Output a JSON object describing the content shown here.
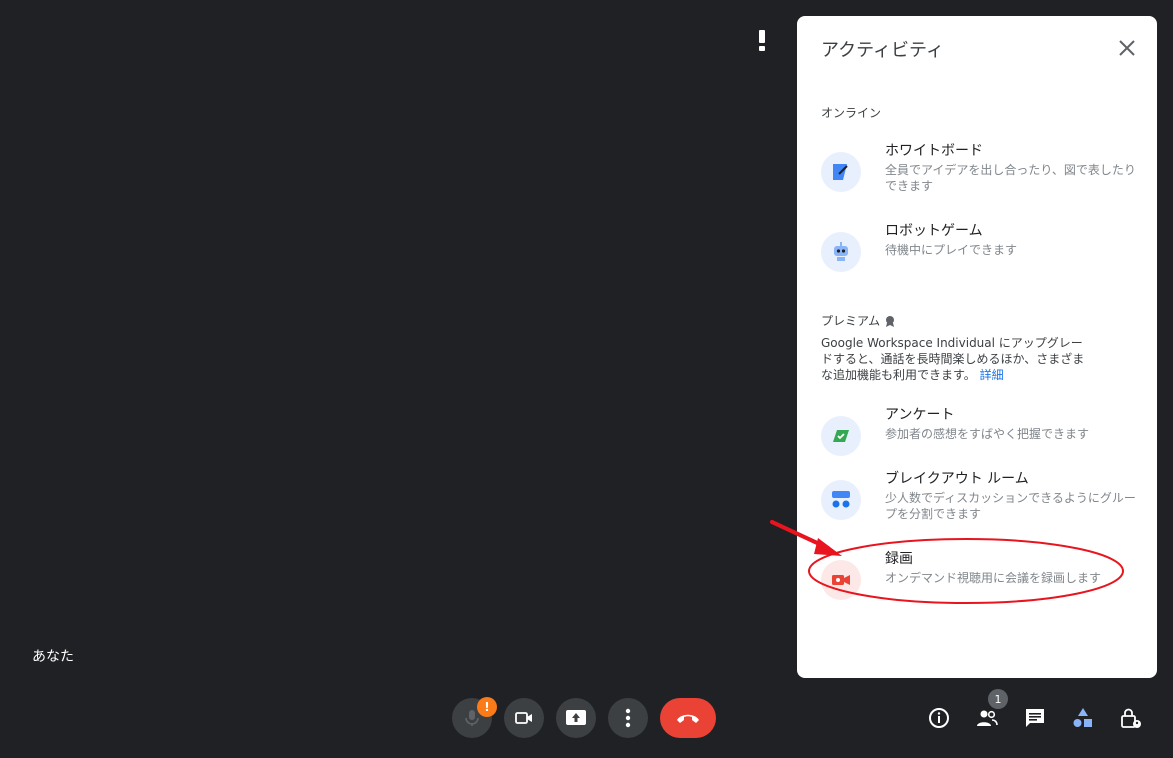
{
  "self_name": "あなた",
  "panel": {
    "title": "アクティビティ",
    "online_label": "オンライン",
    "premium_label": "プレミアム",
    "promo_text": "Google Workspace Individual にアップグレードすると、通話を長時間楽しめるほか、さまざまな追加機能も利用できます。",
    "promo_link": "詳細",
    "items": [
      {
        "title": "ホワイトボード",
        "desc": "全員でアイデアを出し合ったり、図で表したりできます",
        "icon": "whiteboard-icon"
      },
      {
        "title": "ロボットゲーム",
        "desc": "待機中にプレイできます",
        "icon": "robot-game-icon"
      },
      {
        "title": "アンケート",
        "desc": "参加者の感想をすばやく把握できます",
        "icon": "poll-icon"
      },
      {
        "title": "ブレイクアウト ルーム",
        "desc": "少人数でディスカッションできるようにグループを分割できます",
        "icon": "breakout-rooms-icon"
      },
      {
        "title": "録画",
        "desc": "オンデマンド視聴用に会議を録画します",
        "icon": "recording-icon"
      }
    ]
  },
  "controls": {
    "mic_badge": "!",
    "participant_count": "1"
  },
  "colors": {
    "background": "#202124",
    "panel": "#ffffff",
    "hangup": "#ea4335",
    "mic_badge": "#fa7b17",
    "link": "#1a73e8",
    "annotation": "#e8141e"
  }
}
